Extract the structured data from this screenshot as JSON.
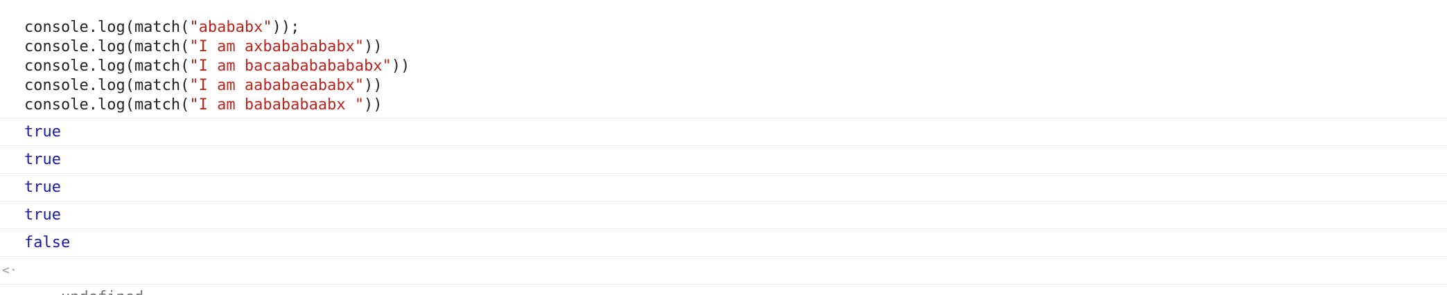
{
  "input": {
    "lines": [
      {
        "prefix": "console.log(match(",
        "arg": "\"abababx\"",
        "suffix": "));"
      },
      {
        "prefix": "console.log(match(",
        "arg": "\"I am axbababababx\"",
        "suffix": "))"
      },
      {
        "prefix": "console.log(match(",
        "arg": "\"I am bacaabababababx\"",
        "suffix": "))"
      },
      {
        "prefix": "console.log(match(",
        "arg": "\"I am aababaeababx\"",
        "suffix": "))"
      },
      {
        "prefix": "console.log(match(",
        "arg": "\"I am babababaabx \"",
        "suffix": "))"
      }
    ]
  },
  "outputs": [
    "true",
    "true",
    "true",
    "true",
    "false"
  ],
  "result": {
    "icon": "return-arrow-icon",
    "glyph": "<·",
    "value": "undefined"
  },
  "colors": {
    "string": "#b3261e",
    "boolean": "#1a1aa6",
    "undefined": "#757575"
  }
}
